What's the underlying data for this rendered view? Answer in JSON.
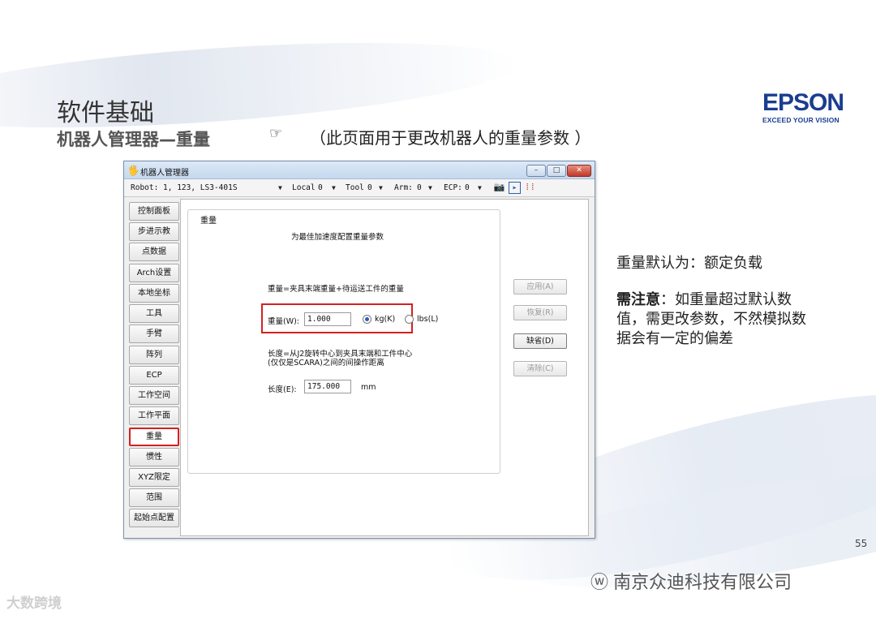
{
  "slide": {
    "title": "软件基础",
    "subtitle": "机器人管理器—重量",
    "note": "（此页面用于更改机器人的重量参数 ）",
    "page_number": "55"
  },
  "logo": {
    "main": "EPSON",
    "tagline": "EXCEED YOUR VISION"
  },
  "window": {
    "title": "机器人管理器",
    "buttons": {
      "minimize": "–",
      "maximize": "□",
      "close": "✕"
    },
    "toolbar": {
      "robot": "Robot: 1, 123, LS3-401S",
      "local_label": "Local",
      "local_value": "0",
      "tool_label": "Tool",
      "tool_value": "0",
      "arm_label": "Arm:",
      "arm_value": "0",
      "ecp_label": "ECP:",
      "ecp_value": "0"
    },
    "nav_items": [
      "控制面板",
      "步进示教",
      "点数据",
      "Arch设置",
      "本地坐标",
      "工具",
      "手臂",
      "阵列",
      "ECP",
      "工作空间",
      "工作平面",
      "重量",
      "惯性",
      "XYZ限定",
      "范围",
      "起始点配置"
    ],
    "active_nav": "重量",
    "panel": {
      "group_title": "重量",
      "heading": "为最佳加速度配置重量参数",
      "weight_desc": "重量=夹具末端重量+待运送工件的重量",
      "weight_label": "重量(W):",
      "weight_value": "1.000",
      "unit_kg": "kg(K)",
      "unit_lbs": "lbs(L)",
      "selected_unit": "kg",
      "length_desc_line1": "长度=从J2旋转中心到夹具末端和工件中心",
      "length_desc_line2": "(仅仅是SCARA)之间的间操作距离",
      "length_label": "长度(E):",
      "length_value": "175.000",
      "length_unit": "mm"
    },
    "side_buttons": {
      "apply": "应用(A)",
      "restore": "恢复(R)",
      "default": "缺省(D)",
      "clear": "清除(C)"
    }
  },
  "description": {
    "line1": "重量默认为：额定负载",
    "caution_label": "需注意",
    "caution_text": "：如重量超过默认数值，需更改参数，不然模拟数据会有一定的偏差"
  },
  "footer": {
    "wechat_account": "南京众迪科技有限公司",
    "watermark": "大数跨境"
  }
}
